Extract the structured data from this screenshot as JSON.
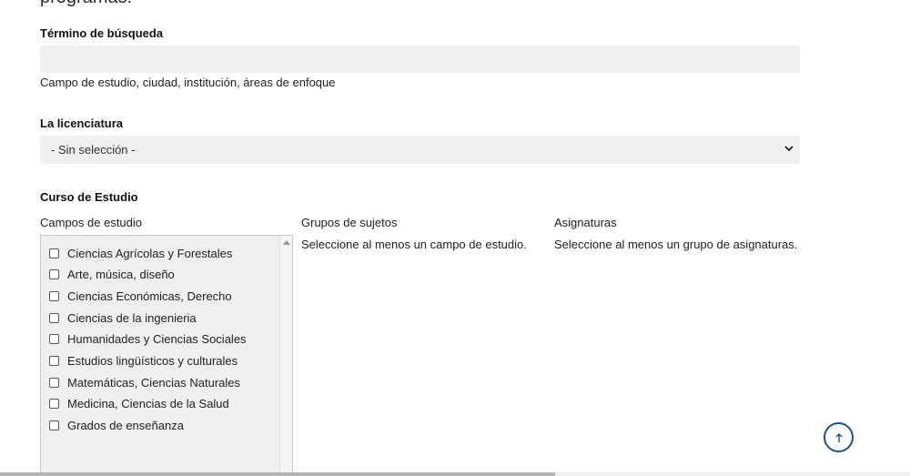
{
  "header": {
    "cut_text": "programas."
  },
  "search": {
    "label": "Término de búsqueda",
    "value": "",
    "placeholder": "",
    "hint": "Campo de estudio, ciudad, institución, áreas de enfoque"
  },
  "degree": {
    "label": "La licenciatura",
    "selected": "- Sin selección -"
  },
  "course": {
    "label": "Curso de Estudio",
    "fields": {
      "label": "Campos de estudio",
      "items": [
        "Ciencias Agrícolas y Forestales",
        "Arte, música, diseño",
        "Ciencias Económicas, Derecho",
        "Ciencias de la ingenieria",
        "Humanidades y Ciencias Sociales",
        "Estudios lingüísticos y culturales",
        "Matemáticas, Ciencias Naturales",
        "Medicina, Ciencias de la Salud",
        "Grados de enseñanza"
      ]
    },
    "groups": {
      "label": "Grupos de sujetos",
      "message": "Seleccione al menos un campo de estudio."
    },
    "subjects": {
      "label": "Asignaturas",
      "message": "Seleccione al menos un grupo de asignaturas."
    }
  },
  "icons": {
    "scroll_top": "arrow-up-icon",
    "select": "chevron-down-icon"
  }
}
